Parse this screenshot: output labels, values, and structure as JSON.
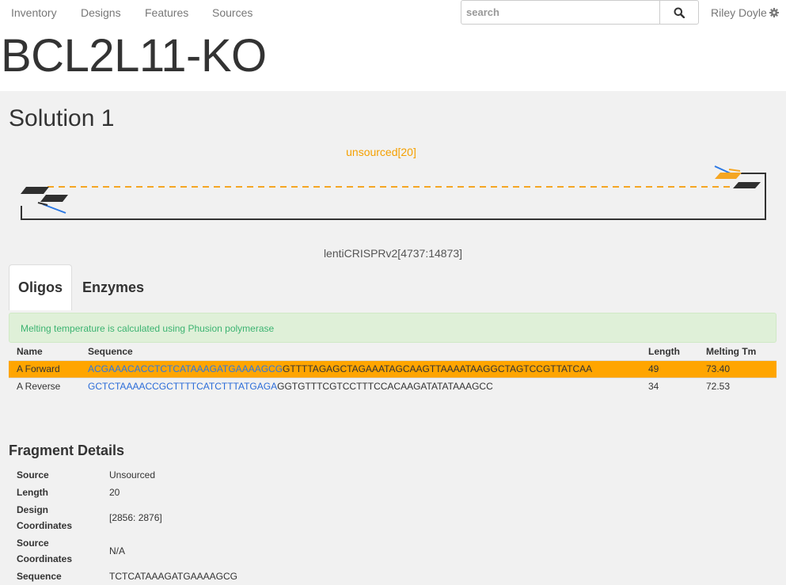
{
  "nav": {
    "links": [
      "Inventory",
      "Designs",
      "Features",
      "Sources"
    ],
    "search_placeholder": "search",
    "user": "Riley Doyle"
  },
  "page_title": "BCL2L11-KO",
  "solution": {
    "title": "Solution 1",
    "fragment_label": "unsourced[20]",
    "vector_label": "lentiCRISPRv2[4737:14873]"
  },
  "tabs": [
    {
      "label": "Oligos",
      "active": true
    },
    {
      "label": "Enzymes",
      "active": false
    }
  ],
  "alert": "Melting temperature is calculated using Phusion polymerase",
  "oligo_table": {
    "headers": [
      "Name",
      "Sequence",
      "Length",
      "Melting Tm"
    ],
    "rows": [
      {
        "name": "A Forward",
        "overlap": "ACGAAACACCTCTCATAAAGATGAAAAGCG",
        "binding": "GTTTTAGAGCTAGAAATAGCAAGTTAAAATAAGGCTAGTCCGTTATCAA",
        "length": "49",
        "tm": "73.40",
        "selected": true
      },
      {
        "name": "A Reverse",
        "overlap": "GCTCTAAAACCGCTTTTCATCTTTATGAGA",
        "binding": "GGTGTTTCGTCCTTTCCACAAGATATATAAAGCC",
        "length": "34",
        "tm": "72.53",
        "selected": false
      }
    ]
  },
  "fragment_details": {
    "title": "Fragment Details",
    "rows": [
      {
        "label": "Source",
        "value": "Unsourced"
      },
      {
        "label": "Length",
        "value": "20"
      },
      {
        "label": "Design Coordinates",
        "value": "[2856: 2876]"
      },
      {
        "label": "Source Coordinates",
        "value": "N/A"
      },
      {
        "label": "Sequence",
        "value": "TCTCATAAAGATGAAAAGCG"
      }
    ]
  },
  "colors": {
    "accent_orange": "#ffa500",
    "overlap_blue": "#2b6cd8",
    "alert_text": "#3cb371",
    "primer_dark": "#2f2f2f"
  }
}
